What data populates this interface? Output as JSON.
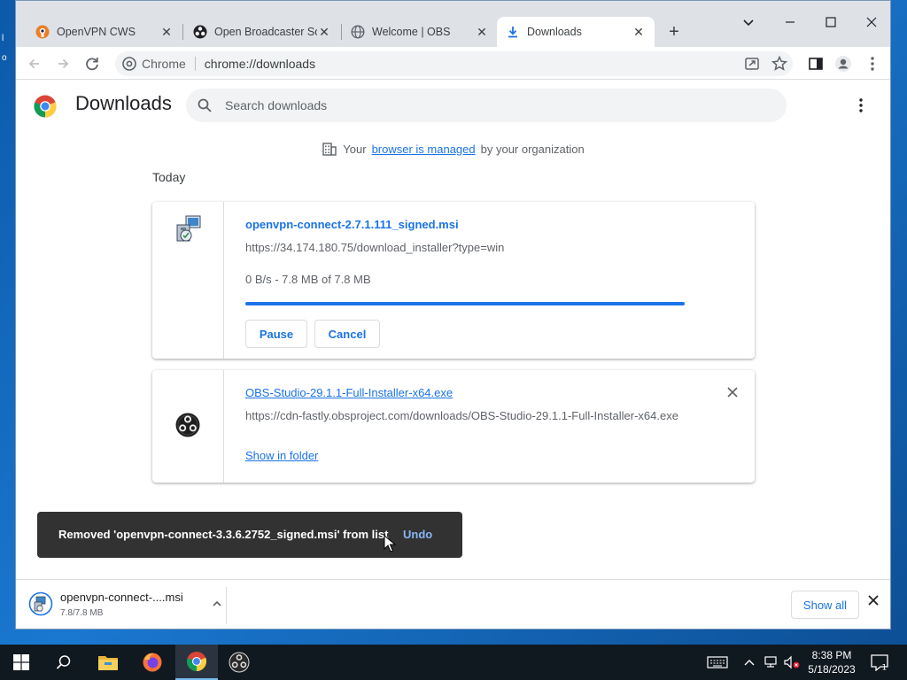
{
  "browser": {
    "tabs": [
      {
        "title": "OpenVPN CWS",
        "icon": "openvpn-icon",
        "active": false
      },
      {
        "title": "Open Broadcaster Soft",
        "icon": "obs-icon",
        "active": false
      },
      {
        "title": "Welcome | OBS",
        "icon": "globe-icon",
        "active": false
      },
      {
        "title": "Downloads",
        "icon": "download-icon",
        "active": true
      }
    ],
    "omnibox": {
      "site_label": "Chrome",
      "url": "chrome://downloads"
    }
  },
  "downloads_page": {
    "title": "Downloads",
    "search_placeholder": "Search downloads",
    "managed": {
      "prefix": "Your",
      "link": "browser is managed",
      "suffix": "by your organization"
    },
    "section_label": "Today",
    "items": [
      {
        "filename": "openvpn-connect-2.7.1.111_signed.msi",
        "url": "https://34.174.180.75/download_installer?type=win",
        "status": "0 B/s - 7.8 MB of 7.8 MB",
        "progress": 1.0,
        "pause_label": "Pause",
        "cancel_label": "Cancel"
      },
      {
        "filename": "OBS-Studio-29.1.1-Full-Installer-x64.exe",
        "url": "https://cdn-fastly.obsproject.com/downloads/OBS-Studio-29.1.1-Full-Installer-x64.exe",
        "show_in_folder_label": "Show in folder"
      }
    ]
  },
  "toast": {
    "message": "Removed 'openvpn-connect-3.3.6.2752_signed.msi' from list",
    "undo_label": "Undo"
  },
  "shelf": {
    "item_name": "openvpn-connect-....msi",
    "item_size": "7.8/7.8 MB",
    "show_all_label": "Show all"
  },
  "taskbar": {
    "time": "8:38 PM",
    "date": "5/18/2023",
    "notification_count": "1"
  },
  "colors": {
    "accent": "#1a73e8",
    "toast_bg": "#323232",
    "undo": "#8ab4f8"
  }
}
